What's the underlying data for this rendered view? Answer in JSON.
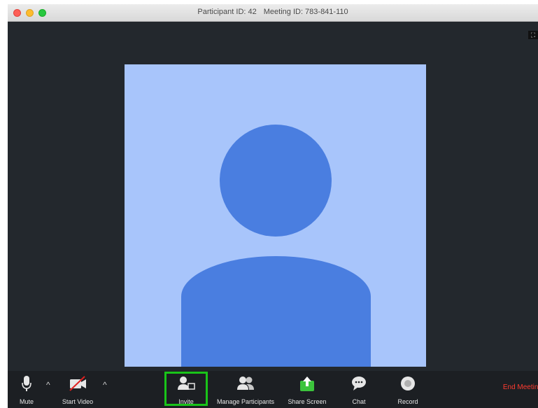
{
  "window": {
    "title_participant": "Participant ID: 42",
    "title_meeting": "Meeting ID: 783-841-110"
  },
  "toolbar": {
    "mute_label": "Mute",
    "start_video_label": "Start Video",
    "invite_label": "Invite",
    "manage_participants_label": "Manage Participants",
    "share_screen_label": "Share Screen",
    "chat_label": "Chat",
    "record_label": "Record",
    "end_meeting_label": "End Meeting"
  },
  "icons": {
    "mute": "microphone-icon",
    "video": "video-camera-off-icon",
    "invite": "add-person-icon",
    "participants": "people-icon",
    "share": "share-screen-icon",
    "chat": "chat-bubble-icon",
    "record": "record-icon"
  },
  "colors": {
    "accent_green": "#19c419",
    "end_red": "#ff3b30",
    "avatar_bg": "#a8c5fb",
    "avatar_fg": "#4a7ee0"
  }
}
